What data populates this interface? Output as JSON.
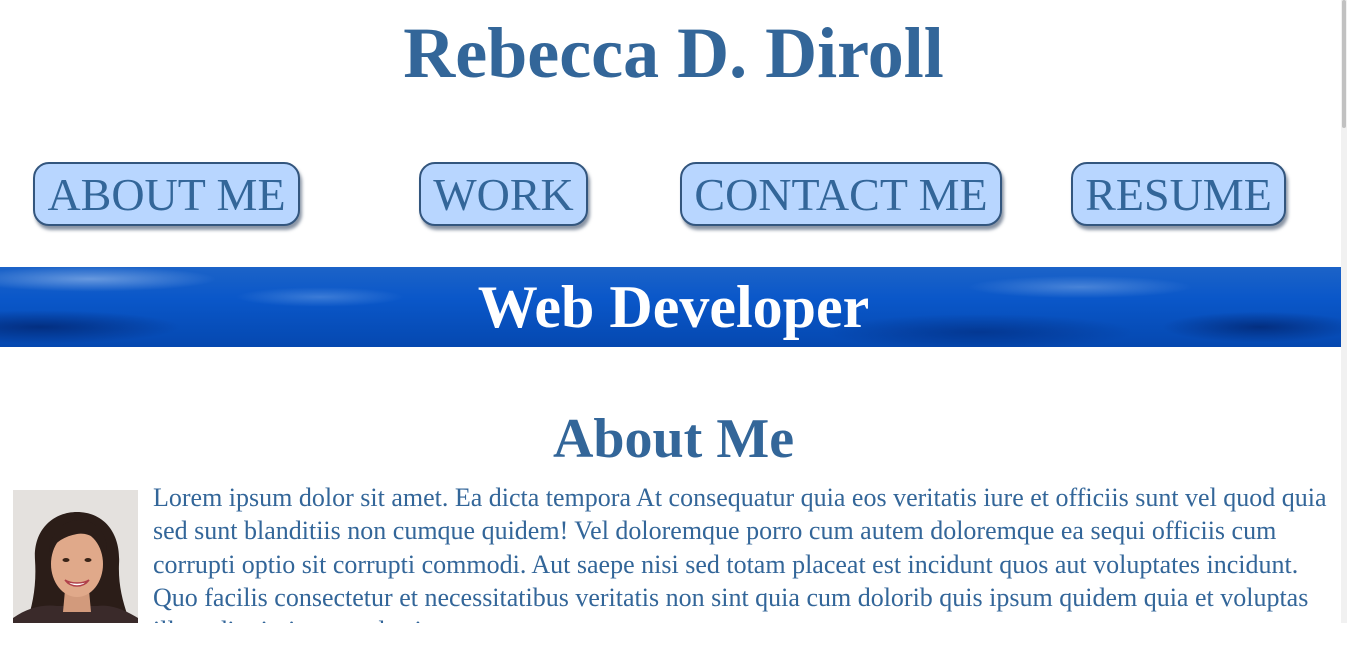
{
  "header": {
    "name": "Rebecca D. Diroll"
  },
  "nav": {
    "items": [
      {
        "label": "ABOUT ME"
      },
      {
        "label": "WORK"
      },
      {
        "label": "CONTACT ME"
      },
      {
        "label": "RESUME"
      }
    ]
  },
  "banner": {
    "title": "Web Developer"
  },
  "about": {
    "heading": "About Me",
    "body": "Lorem ipsum dolor sit amet. Ea dicta tempora At consequatur quia eos veritatis iure et officiis sunt vel quod quia sed sunt blanditiis non cumque quidem! Vel doloremque porro cum autem doloremque ea sequi officiis cum corrupti optio sit corrupti commodi. Aut saepe nisi sed totam placeat est incidunt quos aut voluptates incidunt. Quo facilis consectetur et necessitatibus veritatis non sint quia cum dolorib quis ipsum quidem quia et voluptas illum dignissimos molestias."
  },
  "colors": {
    "accent": "#336699",
    "button_fill": "#b8d6ff",
    "banner_blue": "#0a57c9"
  }
}
